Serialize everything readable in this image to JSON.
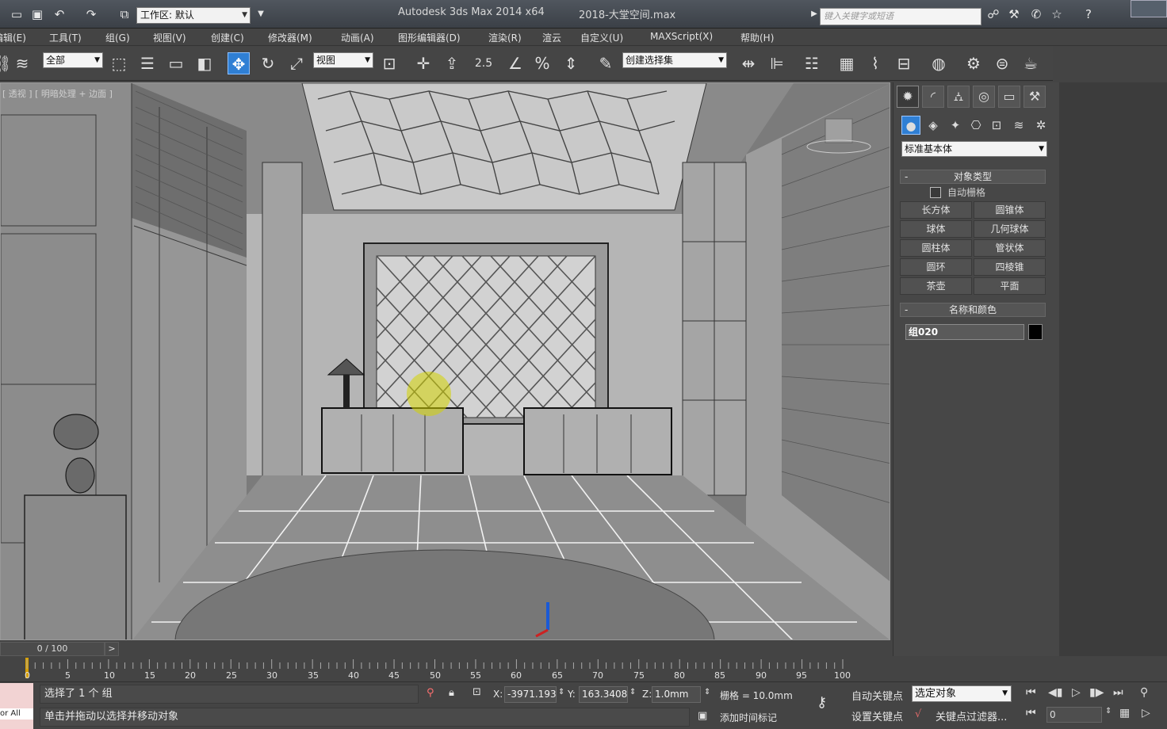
{
  "titlebar": {
    "workspace": "工作区: 默认",
    "app_title": "Autodesk 3ds Max  2014 x64",
    "file_title": "2018-大堂空间.max",
    "search_placeholder": "键入关键字或短语"
  },
  "menu": [
    "编辑(E)",
    "工具(T)",
    "组(G)",
    "视图(V)",
    "创建(C)",
    "修改器(M)",
    "动画(A)",
    "图形编辑器(D)",
    "渲染(R)",
    "渲云",
    "自定义(U)",
    "MAXScript(X)",
    "帮助(H)"
  ],
  "toolbar": {
    "filter": "全部",
    "ref_coord": "视图",
    "snap_angle_label": "2.5",
    "selection_set": "创建选择集"
  },
  "viewport": {
    "label": "[ 透视 ] [ 明暗处理 + 边面 ]"
  },
  "command_panel": {
    "category": "标准基本体",
    "object_type_title": "对象类型",
    "auto_grid": "自动栅格",
    "objects": [
      "长方体",
      "圆锥体",
      "球体",
      "几何球体",
      "圆柱体",
      "管状体",
      "圆环",
      "四棱锥",
      "茶壶",
      "平面"
    ],
    "name_color_title": "名称和颜色",
    "object_name": "组020"
  },
  "timeline": {
    "position": "0 / 100",
    "next": ">",
    "ticks": [
      "0",
      "5",
      "10",
      "15",
      "20",
      "25",
      "30",
      "35",
      "40",
      "45",
      "50",
      "55",
      "60",
      "65",
      "70",
      "75",
      "80",
      "85",
      "90",
      "95",
      "100"
    ]
  },
  "status": {
    "left_label": "or All",
    "selection_info": "选择了 1 个 组",
    "prompt": "单击并拖动以选择并移动对象",
    "x_label": "X:",
    "x_value": "-3971.193",
    "y_label": "Y:",
    "y_value": "163.3408n",
    "z_label": "Z:",
    "z_value": "1.0mm",
    "grid": "栅格 = 10.0mm",
    "add_time_tag": "添加时间标记",
    "auto_key": "自动关键点",
    "set_key": "设置关键点",
    "key_mode": "选定对象",
    "key_filters": "关键点过滤器...",
    "frame": "0"
  }
}
